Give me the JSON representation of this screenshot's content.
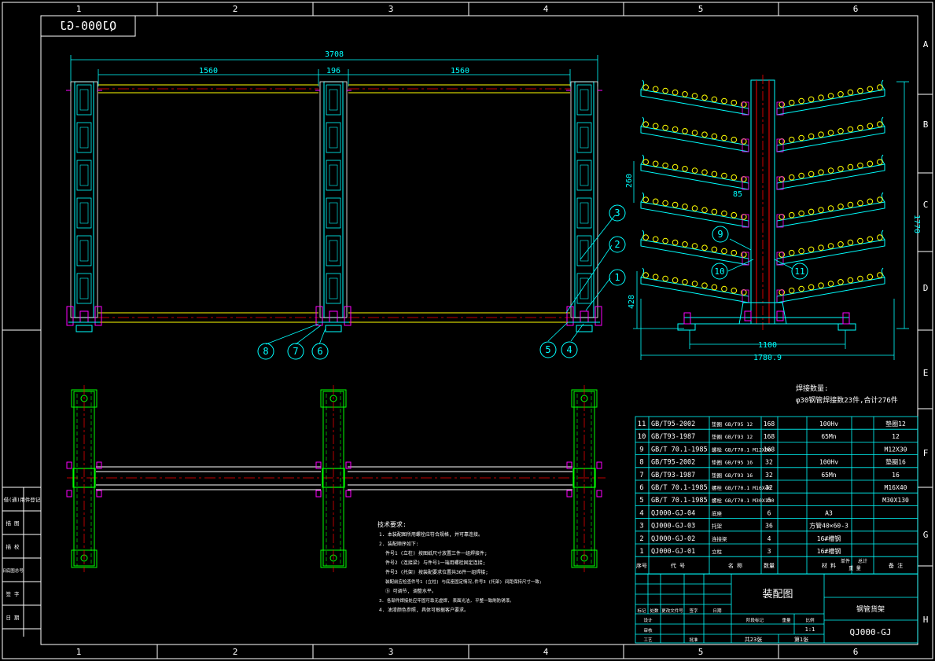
{
  "colors": {
    "frame": "#ffffff",
    "cyan": "#00ffff",
    "green": "#00ff00",
    "yellow": "#ffff00",
    "magenta": "#ff00ff",
    "red": "#ff0000",
    "bg": "#000000"
  },
  "zones": {
    "cols": [
      "1",
      "2",
      "3",
      "4",
      "5",
      "6"
    ],
    "rows": [
      "A",
      "B",
      "C",
      "D",
      "E",
      "F",
      "G",
      "H"
    ]
  },
  "code_box": "QJ000-GJ",
  "front_view": {
    "dim_total": "3708",
    "dim_left": "1560",
    "dim_mid": "196",
    "dim_right": "1560"
  },
  "side_view": {
    "dim_height": "1770",
    "dim_pitch": "260",
    "dim_angle": "85",
    "dim_base": "428",
    "dim_span": "1100",
    "dim_total": "1780.9"
  },
  "balloons": [
    "1",
    "2",
    "3",
    "4",
    "5",
    "6",
    "7",
    "8",
    "9",
    "10",
    "11"
  ],
  "note_top": {
    "line1": "焊接数量:",
    "line2": "φ30钢管焊接数23件,合计276件"
  },
  "tech_notes": {
    "title": "技术要求:",
    "lines": [
      "1. 本装配图所用螺栓应符合规格, 并可靠连接。",
      "2. 装配顺序如下:",
      "件号1 (立柱) 按图纸尺寸放置三件一组焊接件;",
      "件号2 (连接梁) 与件号1一端用螺栓固定连接;",
      "件号3 (托架) 按装配要求位置共36件一组焊接;",
      "装配前应检查件号1 (立柱) 与底座固定情况,件号3 (托架) 间距保持尺寸一致;",
      "⑤ 可调节, 调整水平。",
      "3. 各部件焊接处应牢固可靠无虚焊, 表面光洁, 平整一致刷防锈漆。",
      "4. 油漆颜色参照, 具体可根据客户要求。"
    ]
  },
  "bom": {
    "rows": [
      {
        "no": "11",
        "code": "GB/T95-2002",
        "name": "垫圈 GB/T95 12",
        "qty": "168",
        "mat": "100Hv",
        "note": "垫圈12"
      },
      {
        "no": "10",
        "code": "GB/T93-1987",
        "name": "垫圈 GB/T93 12",
        "qty": "168",
        "mat": "65Mn",
        "note": "12"
      },
      {
        "no": "9",
        "code": "GB/T 70.1-1985",
        "name": "螺栓 GB/T70.1 M12X30",
        "qty": "168",
        "mat": "",
        "note": "M12X30"
      },
      {
        "no": "8",
        "code": "GB/T95-2002",
        "name": "垫圈 GB/T95 16",
        "qty": "32",
        "mat": "100Hv",
        "note": "垫圈16"
      },
      {
        "no": "7",
        "code": "GB/T93-1987",
        "name": "垫圈 GB/T93 16",
        "qty": "32",
        "mat": "65Mn",
        "note": "16"
      },
      {
        "no": "6",
        "code": "GB/T 70.1-1985",
        "name": "螺栓 GB/T70.1 M16X40",
        "qty": "32",
        "mat": "",
        "note": "M16X40"
      },
      {
        "no": "5",
        "code": "GB/T 70.1-1985",
        "name": "螺栓 GB/T70.1 M30X130",
        "qty": "6",
        "mat": "",
        "note": "M30X130"
      },
      {
        "no": "4",
        "code": "QJ000-GJ-04",
        "name": "底座",
        "qty": "6",
        "mat": "A3",
        "note": ""
      },
      {
        "no": "3",
        "code": "QJ000-GJ-03",
        "name": "托架",
        "qty": "36",
        "mat": "方管40×60-3",
        "note": ""
      },
      {
        "no": "2",
        "code": "QJ000-GJ-02",
        "name": "连接梁",
        "qty": "4",
        "mat": "16#槽钢",
        "note": ""
      },
      {
        "no": "1",
        "code": "QJ000-GJ-01",
        "name": "立柱",
        "qty": "3",
        "mat": "16#槽钢",
        "note": ""
      }
    ],
    "header": {
      "no": "序号",
      "code": "代 号",
      "name": "名 称",
      "qty": "数量",
      "mat": "材 料",
      "w1": "单件",
      "w2": "总计",
      "w3": "重 量",
      "note": "备 注"
    }
  },
  "title_block": {
    "drawing_name": "装配图",
    "company": "钢管货架",
    "drawing_no": "QJ000-GJ",
    "scale": "1:1",
    "sheets": "共23张",
    "sheet": "第1张",
    "labels": [
      "标记",
      "处数",
      "更改文件号",
      "签字",
      "日期",
      "设计",
      "审核",
      "工艺",
      "批准",
      "阶段标记",
      "重量",
      "比例"
    ]
  },
  "side_strip": [
    "借(通)用件登记",
    "描 图",
    "描 校",
    "旧底图总号",
    "签 字",
    "日 期"
  ]
}
